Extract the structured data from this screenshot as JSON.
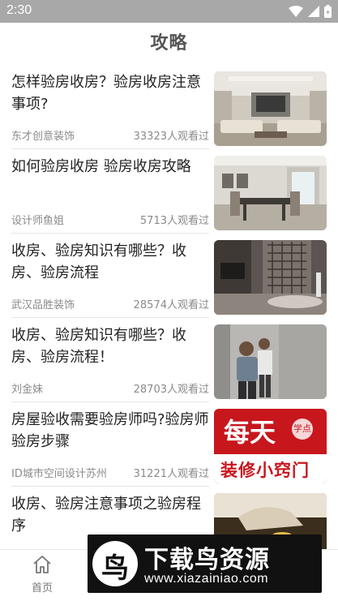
{
  "status_bar": {
    "time": "2:30"
  },
  "header": {
    "title": "攻略"
  },
  "articles": [
    {
      "title": "怎样验房收房？验房收房注意事项?",
      "author": "东才创意装饰",
      "views": "33323人观看过",
      "thumbnail": "living-room-photo"
    },
    {
      "title": "如何验房收房 验房收房攻略",
      "author": "设计师鱼姐",
      "views": "5713人观看过",
      "thumbnail": "dining-room-photo"
    },
    {
      "title": "收房、验房知识有哪些？收房、验房流程",
      "author": "武汉品胜装饰",
      "views": "28574人观看过",
      "thumbnail": "interior-partition-photo"
    },
    {
      "title": "收房、验房知识有哪些？收房、验房流程！",
      "author": "刘金妹",
      "views": "28703人观看过",
      "thumbnail": "inspection-workers-photo"
    },
    {
      "title": "房屋验收需要验房师吗?验房师验房步骤",
      "author": "ID城市空间设计苏州",
      "views": "31221人观看过",
      "thumbnail": "red-poster",
      "thumb_text_main": "每天",
      "thumb_text_badge": "学点",
      "thumb_text_bottom": "装修小窍门"
    },
    {
      "title": "收房、验房注意事项之验房程序",
      "author": "",
      "views": "",
      "thumbnail": "gold-coins-photo"
    }
  ],
  "tab_bar": {
    "home_label": "首页",
    "home_icon": "home-icon"
  },
  "watermark": {
    "title": "下载鸟资源",
    "url": "www.xiazainiao.com",
    "logo_char": "鸟"
  }
}
